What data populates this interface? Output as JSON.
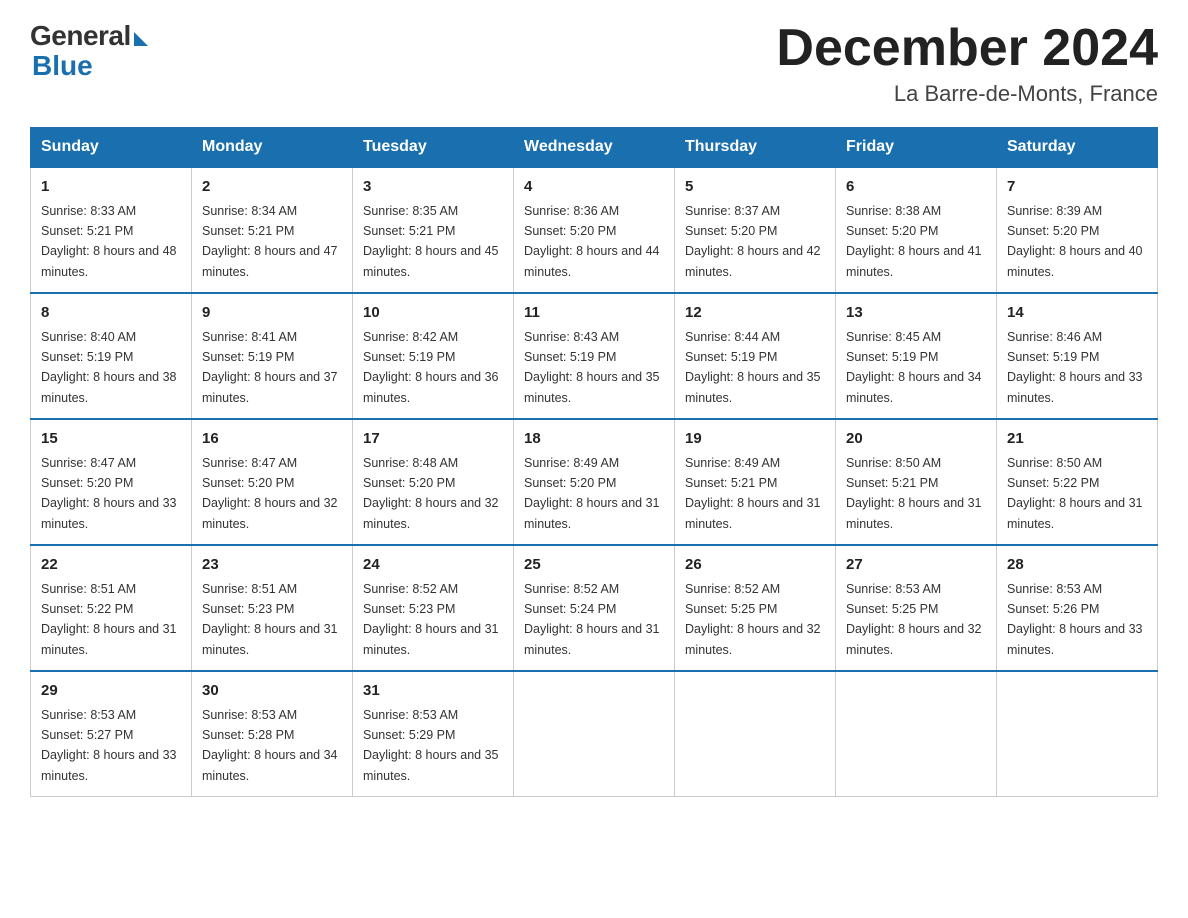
{
  "header": {
    "logo_general": "General",
    "logo_blue": "Blue",
    "title": "December 2024",
    "location": "La Barre-de-Monts, France"
  },
  "days_of_week": [
    "Sunday",
    "Monday",
    "Tuesday",
    "Wednesday",
    "Thursday",
    "Friday",
    "Saturday"
  ],
  "weeks": [
    [
      {
        "day": "1",
        "sunrise": "8:33 AM",
        "sunset": "5:21 PM",
        "daylight": "8 hours and 48 minutes."
      },
      {
        "day": "2",
        "sunrise": "8:34 AM",
        "sunset": "5:21 PM",
        "daylight": "8 hours and 47 minutes."
      },
      {
        "day": "3",
        "sunrise": "8:35 AM",
        "sunset": "5:21 PM",
        "daylight": "8 hours and 45 minutes."
      },
      {
        "day": "4",
        "sunrise": "8:36 AM",
        "sunset": "5:20 PM",
        "daylight": "8 hours and 44 minutes."
      },
      {
        "day": "5",
        "sunrise": "8:37 AM",
        "sunset": "5:20 PM",
        "daylight": "8 hours and 42 minutes."
      },
      {
        "day": "6",
        "sunrise": "8:38 AM",
        "sunset": "5:20 PM",
        "daylight": "8 hours and 41 minutes."
      },
      {
        "day": "7",
        "sunrise": "8:39 AM",
        "sunset": "5:20 PM",
        "daylight": "8 hours and 40 minutes."
      }
    ],
    [
      {
        "day": "8",
        "sunrise": "8:40 AM",
        "sunset": "5:19 PM",
        "daylight": "8 hours and 38 minutes."
      },
      {
        "day": "9",
        "sunrise": "8:41 AM",
        "sunset": "5:19 PM",
        "daylight": "8 hours and 37 minutes."
      },
      {
        "day": "10",
        "sunrise": "8:42 AM",
        "sunset": "5:19 PM",
        "daylight": "8 hours and 36 minutes."
      },
      {
        "day": "11",
        "sunrise": "8:43 AM",
        "sunset": "5:19 PM",
        "daylight": "8 hours and 35 minutes."
      },
      {
        "day": "12",
        "sunrise": "8:44 AM",
        "sunset": "5:19 PM",
        "daylight": "8 hours and 35 minutes."
      },
      {
        "day": "13",
        "sunrise": "8:45 AM",
        "sunset": "5:19 PM",
        "daylight": "8 hours and 34 minutes."
      },
      {
        "day": "14",
        "sunrise": "8:46 AM",
        "sunset": "5:19 PM",
        "daylight": "8 hours and 33 minutes."
      }
    ],
    [
      {
        "day": "15",
        "sunrise": "8:47 AM",
        "sunset": "5:20 PM",
        "daylight": "8 hours and 33 minutes."
      },
      {
        "day": "16",
        "sunrise": "8:47 AM",
        "sunset": "5:20 PM",
        "daylight": "8 hours and 32 minutes."
      },
      {
        "day": "17",
        "sunrise": "8:48 AM",
        "sunset": "5:20 PM",
        "daylight": "8 hours and 32 minutes."
      },
      {
        "day": "18",
        "sunrise": "8:49 AM",
        "sunset": "5:20 PM",
        "daylight": "8 hours and 31 minutes."
      },
      {
        "day": "19",
        "sunrise": "8:49 AM",
        "sunset": "5:21 PM",
        "daylight": "8 hours and 31 minutes."
      },
      {
        "day": "20",
        "sunrise": "8:50 AM",
        "sunset": "5:21 PM",
        "daylight": "8 hours and 31 minutes."
      },
      {
        "day": "21",
        "sunrise": "8:50 AM",
        "sunset": "5:22 PM",
        "daylight": "8 hours and 31 minutes."
      }
    ],
    [
      {
        "day": "22",
        "sunrise": "8:51 AM",
        "sunset": "5:22 PM",
        "daylight": "8 hours and 31 minutes."
      },
      {
        "day": "23",
        "sunrise": "8:51 AM",
        "sunset": "5:23 PM",
        "daylight": "8 hours and 31 minutes."
      },
      {
        "day": "24",
        "sunrise": "8:52 AM",
        "sunset": "5:23 PM",
        "daylight": "8 hours and 31 minutes."
      },
      {
        "day": "25",
        "sunrise": "8:52 AM",
        "sunset": "5:24 PM",
        "daylight": "8 hours and 31 minutes."
      },
      {
        "day": "26",
        "sunrise": "8:52 AM",
        "sunset": "5:25 PM",
        "daylight": "8 hours and 32 minutes."
      },
      {
        "day": "27",
        "sunrise": "8:53 AM",
        "sunset": "5:25 PM",
        "daylight": "8 hours and 32 minutes."
      },
      {
        "day": "28",
        "sunrise": "8:53 AM",
        "sunset": "5:26 PM",
        "daylight": "8 hours and 33 minutes."
      }
    ],
    [
      {
        "day": "29",
        "sunrise": "8:53 AM",
        "sunset": "5:27 PM",
        "daylight": "8 hours and 33 minutes."
      },
      {
        "day": "30",
        "sunrise": "8:53 AM",
        "sunset": "5:28 PM",
        "daylight": "8 hours and 34 minutes."
      },
      {
        "day": "31",
        "sunrise": "8:53 AM",
        "sunset": "5:29 PM",
        "daylight": "8 hours and 35 minutes."
      },
      null,
      null,
      null,
      null
    ]
  ]
}
